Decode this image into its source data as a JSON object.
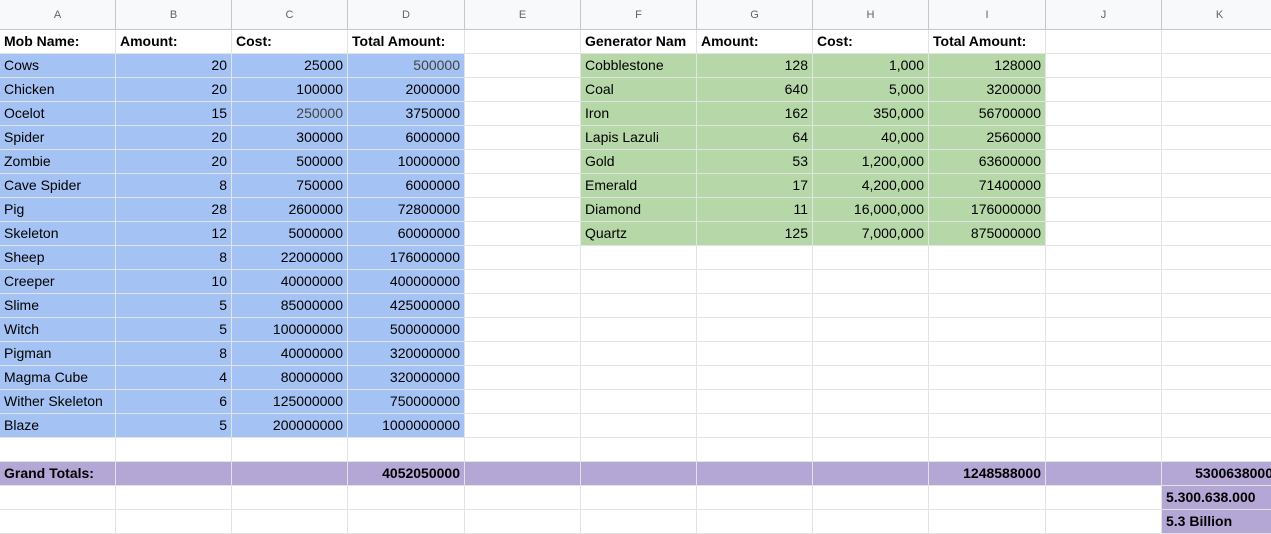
{
  "columns": [
    "A",
    "B",
    "C",
    "D",
    "E",
    "F",
    "G",
    "H",
    "I",
    "J",
    "K"
  ],
  "headers": {
    "mob_name": "Mob Name:",
    "mob_amount": "Amount:",
    "mob_cost": "Cost:",
    "mob_total": "Total Amount:",
    "gen_name": "Generator Nam",
    "gen_amount": "Amount:",
    "gen_cost": "Cost:",
    "gen_total": "Total Amount:"
  },
  "mobs": [
    {
      "name": "Cows",
      "amount": "20",
      "cost": "25000",
      "total": "500000"
    },
    {
      "name": "Chicken",
      "amount": "20",
      "cost": "100000",
      "total": "2000000"
    },
    {
      "name": "Ocelot",
      "amount": "15",
      "cost": "250000",
      "total": "3750000"
    },
    {
      "name": "Spider",
      "amount": "20",
      "cost": "300000",
      "total": "6000000"
    },
    {
      "name": "Zombie",
      "amount": "20",
      "cost": "500000",
      "total": "10000000"
    },
    {
      "name": "Cave Spider",
      "amount": "8",
      "cost": "750000",
      "total": "6000000"
    },
    {
      "name": "Pig",
      "amount": "28",
      "cost": "2600000",
      "total": "72800000"
    },
    {
      "name": "Skeleton",
      "amount": "12",
      "cost": "5000000",
      "total": "60000000"
    },
    {
      "name": "Sheep",
      "amount": "8",
      "cost": "22000000",
      "total": "176000000"
    },
    {
      "name": "Creeper",
      "amount": "10",
      "cost": "40000000",
      "total": "400000000"
    },
    {
      "name": "Slime",
      "amount": "5",
      "cost": "85000000",
      "total": "425000000"
    },
    {
      "name": "Witch",
      "amount": "5",
      "cost": "100000000",
      "total": "500000000"
    },
    {
      "name": "Pigman",
      "amount": "8",
      "cost": "40000000",
      "total": "320000000"
    },
    {
      "name": "Magma Cube",
      "amount": "4",
      "cost": "80000000",
      "total": "320000000"
    },
    {
      "name": "Wither Skeleton",
      "amount": "6",
      "cost": "125000000",
      "total": "750000000"
    },
    {
      "name": "Blaze",
      "amount": "5",
      "cost": "200000000",
      "total": "1000000000"
    }
  ],
  "generators": [
    {
      "name": "Cobblestone",
      "amount": "128",
      "cost": "1,000",
      "total": "128000"
    },
    {
      "name": "Coal",
      "amount": "640",
      "cost": "5,000",
      "total": "3200000"
    },
    {
      "name": "Iron",
      "amount": "162",
      "cost": "350,000",
      "total": "56700000"
    },
    {
      "name": "Lapis Lazuli",
      "amount": "64",
      "cost": "40,000",
      "total": "2560000"
    },
    {
      "name": "Gold",
      "amount": "53",
      "cost": "1,200,000",
      "total": "63600000"
    },
    {
      "name": "Emerald",
      "amount": "17",
      "cost": "4,200,000",
      "total": "71400000"
    },
    {
      "name": "Diamond",
      "amount": "11",
      "cost": "16,000,000",
      "total": "176000000"
    },
    {
      "name": "Quartz",
      "amount": "125",
      "cost": "7,000,000",
      "total": "875000000"
    }
  ],
  "grand_totals": {
    "label": "Grand Totals:",
    "mob_total": "4052050000",
    "gen_total": "1248588000",
    "combined": "5300638000",
    "combined_dotted": "5.300.638.000",
    "combined_words": "5.3 Billion"
  },
  "colors": {
    "mob_fill": "#a4c2f4",
    "generator_fill": "#b6d7a8",
    "totals_fill": "#b4a7d6"
  }
}
